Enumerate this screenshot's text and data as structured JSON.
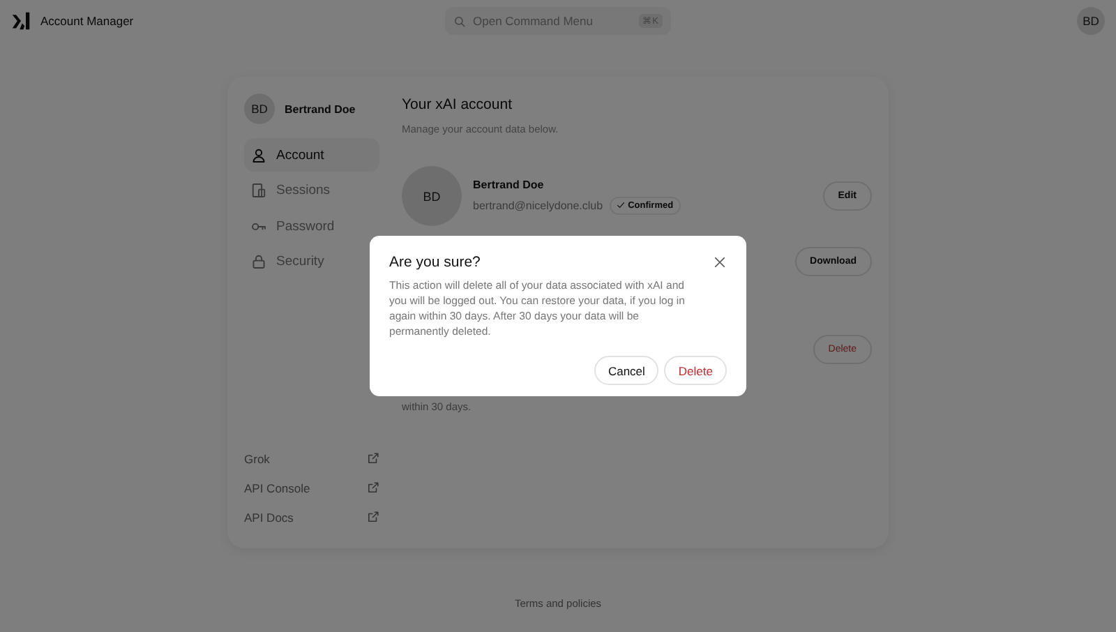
{
  "header": {
    "title": "Account Manager",
    "search": {
      "placeholder": "Open Command Menu",
      "shortcut": "⌘K"
    },
    "avatar": "BD"
  },
  "sidebar": {
    "user": {
      "initials": "BD",
      "name": "Bertrand Doe"
    },
    "items": [
      {
        "label": "Account",
        "selected": true
      },
      {
        "label": "Sessions",
        "selected": false
      },
      {
        "label": "Password",
        "selected": false
      },
      {
        "label": "Security",
        "selected": false
      }
    ],
    "links": [
      {
        "label": "Grok"
      },
      {
        "label": "API Console"
      },
      {
        "label": "API Docs"
      }
    ]
  },
  "main": {
    "title": "Your xAI account",
    "subtitle": "Manage your account data below.",
    "profile": {
      "initials": "BD",
      "name": "Bertrand Doe",
      "email": "bertrand@nicelydone.club",
      "badge": "Confirmed",
      "button": "Edit"
    },
    "download": {
      "button": "Download"
    },
    "delete": {
      "description": "within 30 days.",
      "button": "Delete"
    }
  },
  "dialog": {
    "title": "Are you sure?",
    "body": "This action will delete all of your data associated with xAI and you will be logged out. You can restore your data, if you log in again within 30 days. After 30 days your data will be permanently deleted.",
    "cancel": "Cancel",
    "confirm": "Delete"
  },
  "footer": {
    "link": "Terms and policies"
  }
}
